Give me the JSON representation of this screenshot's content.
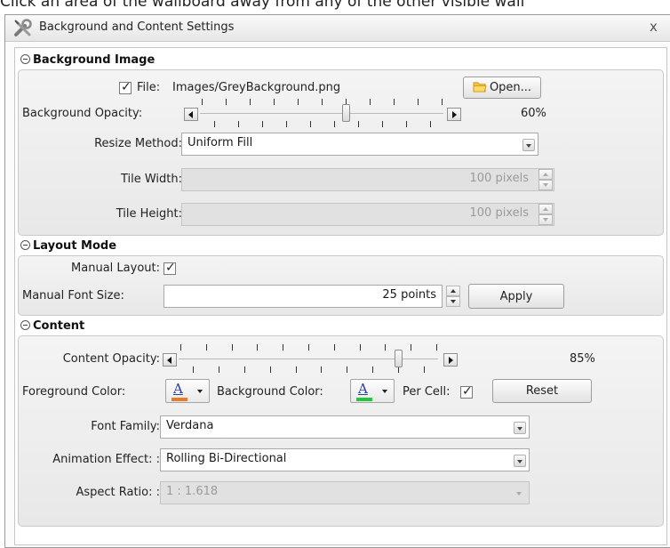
{
  "hint": {
    "text": "Click an area of the wallboard away from any of the other visible wall"
  },
  "window": {
    "title": "Background and Content Settings",
    "close_glyph": "x",
    "icon": "tools-icon"
  },
  "background_image": {
    "header": "Background Image",
    "file_label": "File:",
    "file_checked": true,
    "file_value": "Images/GreyBackground.png",
    "open_label": "Open...",
    "opacity_label": "Background Opacity:",
    "opacity_percent_text": "60%",
    "opacity_fraction": 0.6,
    "resize_label": "Resize Method:",
    "resize_value": "Uniform Fill",
    "tile_width_label": "Tile Width:",
    "tile_width_value": "100 pixels",
    "tile_height_label": "Tile Height:",
    "tile_height_value": "100 pixels"
  },
  "layout_mode": {
    "header": "Layout Mode",
    "manual_layout_label": "Manual Layout:",
    "manual_layout_checked": true,
    "font_size_label": "Manual Font Size:",
    "font_size_value": "25 points",
    "apply_label": "Apply"
  },
  "content": {
    "header": "Content",
    "opacity_label": "Content Opacity:",
    "opacity_percent_text": "85%",
    "opacity_fraction": 0.85,
    "fg_label": "Foreground Color:",
    "fg_color": "#e87a2a",
    "bg_label": "Background Color:",
    "bg_color": "#22c83a",
    "color_glyph": "A",
    "per_cell_label": "Per Cell:",
    "per_cell_checked": true,
    "reset_label": "Reset",
    "font_label": "Font Family:",
    "font_value": "Verdana",
    "animation_label": "Animation Effect: :",
    "animation_value": "Rolling Bi-Directional",
    "aspect_label": "Aspect Ratio: :",
    "aspect_value": "1 : 1.618"
  },
  "checkmark_glyph": "✓"
}
